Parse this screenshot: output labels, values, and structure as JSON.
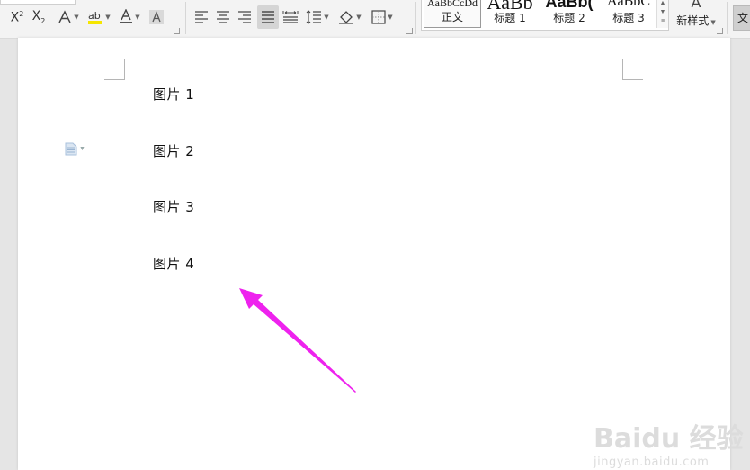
{
  "ribbon": {
    "font_group": {
      "superscript_label": "X",
      "superscript_mark": "2",
      "subscript_label": "X",
      "subscript_mark": "2",
      "icons": [
        "superscript-icon",
        "subscript-icon",
        "text-effect-icon",
        "highlight-icon",
        "font-color-icon",
        "char-shading-icon"
      ]
    },
    "paragraph_group": {
      "icons": [
        "align-left-icon",
        "align-center-icon",
        "align-right-icon",
        "justify-icon",
        "distribute-icon",
        "line-spacing-icon",
        "shading-icon",
        "borders-icon"
      ]
    },
    "styles": {
      "tiles": [
        {
          "preview": "AaBbCcDd",
          "name": "正文"
        },
        {
          "preview": "AaBb",
          "name": "标题 1"
        },
        {
          "preview": "AaBb(",
          "name": "标题 2"
        },
        {
          "preview": "AaBbC",
          "name": "标题 3"
        }
      ],
      "new_style_label": "新样式",
      "right_box_label": "文"
    },
    "colors": {
      "highlight": "#f5e600",
      "justify_active_bg": "#d5d5d5",
      "icon": "#444444"
    }
  },
  "document": {
    "paragraphs": [
      "图片 1",
      "图片 2",
      "图片 3",
      "图片 4"
    ],
    "arrow_color": "#ee22ee"
  },
  "watermark": {
    "logo": "Baidu 经验",
    "url": "jingyan.baidu.com"
  }
}
